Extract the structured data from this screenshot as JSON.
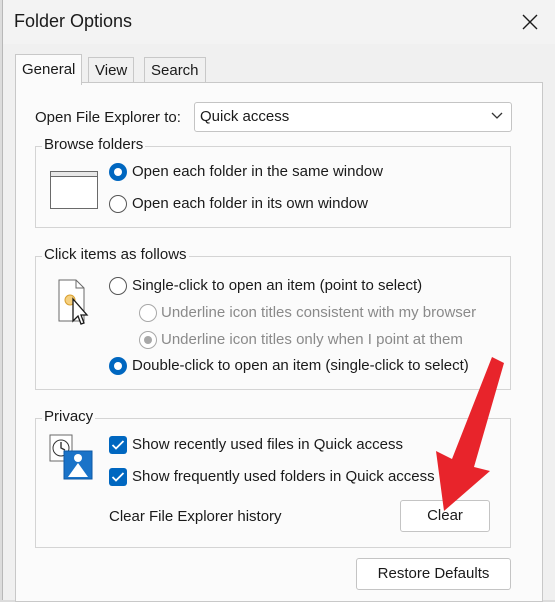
{
  "window": {
    "title": "Folder Options"
  },
  "tabs": [
    "General",
    "View",
    "Search"
  ],
  "open_explorer": {
    "label": "Open File Explorer to:",
    "value": "Quick access"
  },
  "browse": {
    "title": "Browse folders",
    "options": [
      {
        "label": "Open each folder in the same window",
        "selected": true
      },
      {
        "label": "Open each folder in its own window",
        "selected": false
      }
    ]
  },
  "click": {
    "title": "Click items as follows",
    "single": "Single-click to open an item (point to select)",
    "sub1": "Underline icon titles consistent with my browser",
    "sub2": "Underline icon titles only when I point at them",
    "double": "Double-click to open an item (single-click to select)"
  },
  "privacy": {
    "title": "Privacy",
    "recent_files": "Show recently used files in Quick access",
    "frequent_folders": "Show frequently used folders in Quick access",
    "clear_label": "Clear File Explorer history",
    "clear_button": "Clear"
  },
  "restore_button": "Restore Defaults",
  "colors": {
    "accent": "#0067c0",
    "annotation_arrow": "#e8242b"
  }
}
